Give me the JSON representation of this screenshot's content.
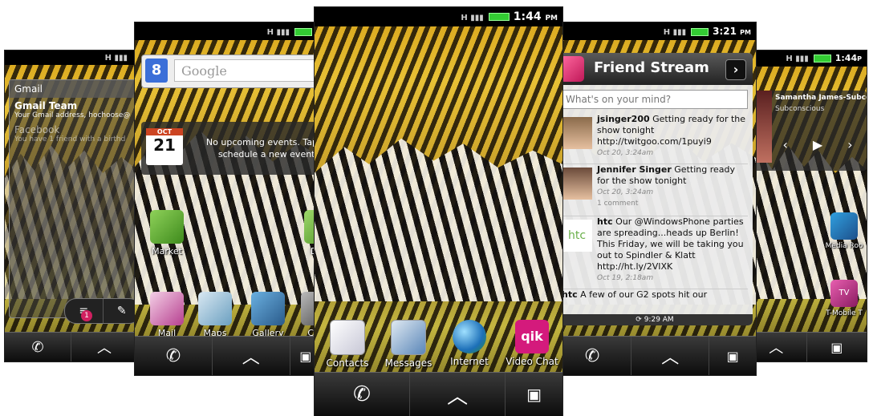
{
  "panel_far_left": {
    "status_time": "",
    "gmail_title": "Gmail",
    "email_from": "Gmail Team",
    "email_preview": "Your Gmail address, hochoose@",
    "email2_from": "Facebook",
    "email2_preview": "You have 1 friend with a birthd",
    "badge_count": "1"
  },
  "panel_left": {
    "search_placeholder": "Google",
    "calendar_month": "OCT",
    "calendar_day": "21",
    "calendar_text": "No upcoming events. Tap schedule a new event.",
    "apps": [
      {
        "label": "Market"
      },
      {
        "label": "Dem"
      },
      {
        "label": "Mail"
      },
      {
        "label": "Maps"
      },
      {
        "label": "Gallery"
      },
      {
        "label": "Cam"
      }
    ]
  },
  "panel_center": {
    "status_time": "1:44",
    "status_ampm": "PM",
    "apps": [
      {
        "label": "Contacts"
      },
      {
        "label": "Messages"
      },
      {
        "label": "Internet"
      },
      {
        "label": "Video Chat"
      }
    ],
    "qik_logo": "qik"
  },
  "panel_right": {
    "status_time": "3:21",
    "status_ampm": "PM",
    "widget_title": "Friend Stream",
    "post_placeholder": "What's on your mind?",
    "posts": [
      {
        "user": "jsinger200",
        "text": "Getting ready for the show tonight  http://twitgoo.com/1puyi9",
        "meta": "Oct 20, 3:24am"
      },
      {
        "user": "Jennifer Singer",
        "text": "Getting ready for the show tonight",
        "meta": "Oct 20, 3:24am",
        "comments": "1 comment"
      },
      {
        "user": "htc",
        "text": "Our @WindowsPhone parties are spreading...heads up Berlin! This Friday, we will be taking you out to Spindler & Klatt http://ht.ly/2VIXK",
        "meta": "Oct 19, 2:18am"
      },
      {
        "user": "htc",
        "text": "A few of our G2 spots hit our",
        "meta": ""
      }
    ],
    "footer_time": "9:29 AM",
    "htc_logo": "htc"
  },
  "panel_far_right": {
    "status_time": "1:44",
    "status_ampm": "P",
    "artist": "Samantha James-Subco",
    "album": "Subconscious",
    "apps": [
      {
        "label": "Media Roo"
      },
      {
        "label": "T-Mobile T"
      }
    ],
    "tv_icon_label": "TV"
  }
}
